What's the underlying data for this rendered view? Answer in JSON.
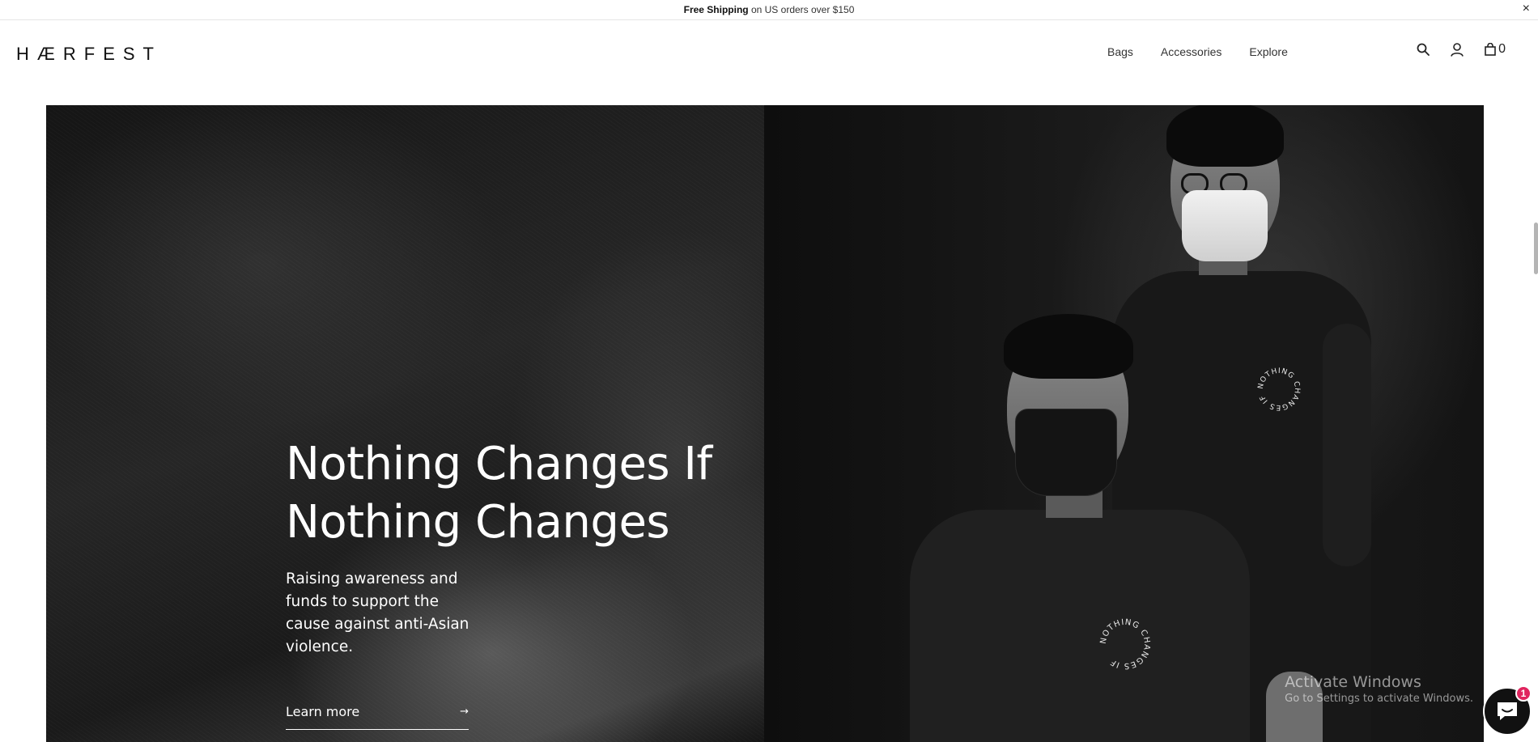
{
  "announcement": {
    "bold_text": "Free Shipping",
    "text": " on US orders over $150",
    "close_label": "×"
  },
  "header": {
    "logo": "HÆRFEST",
    "nav": [
      {
        "label": "Bags"
      },
      {
        "label": "Accessories"
      },
      {
        "label": "Explore"
      }
    ],
    "cart_count": "0",
    "icons": [
      "search-icon",
      "account-icon",
      "cart-icon"
    ]
  },
  "hero": {
    "title_line1": "Nothing Changes If",
    "title_line2": "Nothing Changes",
    "subtitle": "Raising awareness and funds to support the cause against anti-Asian violence.",
    "link_label": "Learn more",
    "link_arrow": "→",
    "shirt_badge_text": "NOTHING CHANGES IF"
  },
  "watermark": {
    "title": "Activate Windows",
    "subtitle": "Go to Settings to activate Windows."
  },
  "chat": {
    "unread_count": "1"
  },
  "colors": {
    "background": "#ffffff",
    "hero_dark": "#0d0d0d",
    "text_primary": "#222222",
    "badge_red": "#e0245e"
  }
}
